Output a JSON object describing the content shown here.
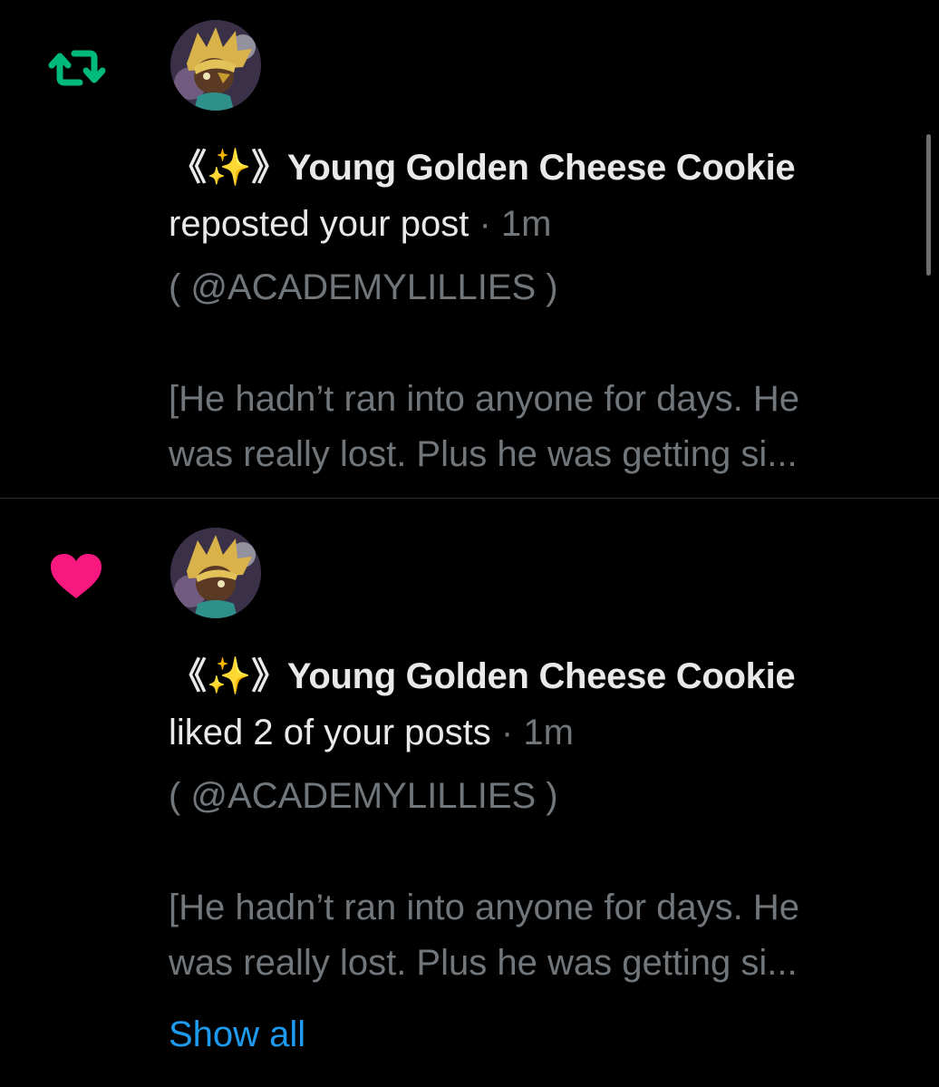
{
  "notifications": [
    {
      "type_icon": "repost-icon",
      "icon_color": "#00ba7c",
      "name": "《✨》Young Golden Cheese Cookie",
      "action": "reposted your post",
      "separator": "·",
      "time": "1m",
      "handle": "( @ACADEMYLILLIES )",
      "preview": "[He hadn’t ran into anyone for days. He\nwas really lost. Plus he was getting si..."
    },
    {
      "type_icon": "heart-icon",
      "icon_color": "#f91880",
      "name": "《✨》Young Golden Cheese Cookie",
      "action": "liked 2 of your posts",
      "separator": "·",
      "time": "1m",
      "handle": "( @ACADEMYLILLIES )",
      "preview": "[He hadn’t ran into anyone for days. He\nwas really lost. Plus he was getting si...",
      "show_all": "Show all"
    }
  ],
  "colors": {
    "background": "#000000",
    "primary_text": "#e7e9ea",
    "secondary_text": "#71767b",
    "link": "#1d9bf0",
    "divider": "#2f3336"
  }
}
